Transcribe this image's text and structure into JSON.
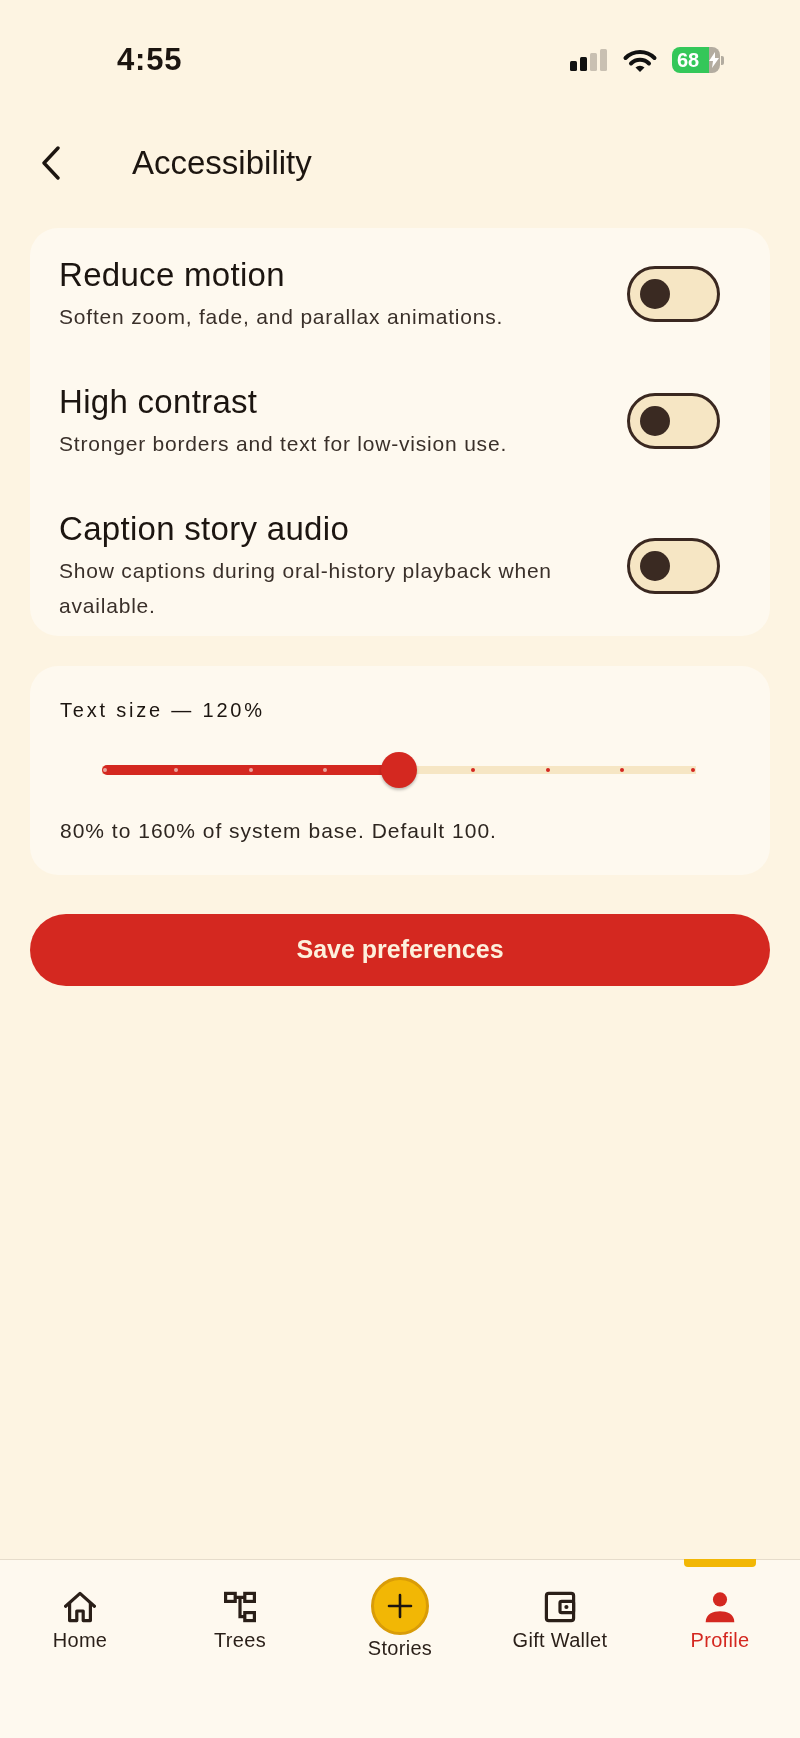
{
  "status_bar": {
    "time": "4:55",
    "battery": "68"
  },
  "header": {
    "title": "Accessibility"
  },
  "toggles": [
    {
      "title": "Reduce motion",
      "description": "Soften zoom, fade, and parallax animations.",
      "on": false
    },
    {
      "title": "High contrast",
      "description": "Stronger borders and text for low-vision use.",
      "on": false
    },
    {
      "title": "Caption story audio",
      "description": "Show captions during oral-history playback when available.",
      "on": false
    }
  ],
  "text_size": {
    "label": "Text size — 120%",
    "level": 0.5,
    "note": "80% to 160% of system base. Default 100."
  },
  "save_button": {
    "label": "Save preferences"
  },
  "tab_bar": {
    "items": [
      {
        "label": "Home",
        "kind": "tab",
        "selected": false
      },
      {
        "label": "Trees",
        "kind": "tab",
        "selected": false
      },
      {
        "label": "Stories",
        "kind": "action",
        "selected": false
      },
      {
        "label": "Gift Wallet",
        "kind": "tab",
        "selected": false
      },
      {
        "label": "Profile",
        "kind": "tab",
        "selected": true
      }
    ]
  }
}
